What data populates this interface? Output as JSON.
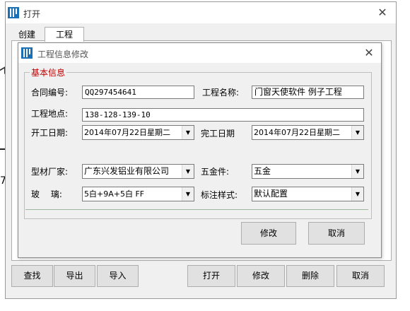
{
  "outer_window": {
    "title": "打开",
    "close_glyph": "✕",
    "tabs": [
      "创建",
      "工程"
    ]
  },
  "inner_dialog": {
    "title": "工程信息修改",
    "close_glyph": "✕",
    "group_title": "基本信息",
    "fields": {
      "contract_no": {
        "label": "合同编号:",
        "value": "QQ297454641"
      },
      "project_name": {
        "label": "工程名称:",
        "value": "门窗天使软件 例子工程"
      },
      "project_site": {
        "label": "工程地点:",
        "value": "138-128-139-10"
      },
      "start_date": {
        "label": "开工日期:",
        "value": "2014年07月22日星期二"
      },
      "finish_date": {
        "label": "完工日期",
        "value": "2014年07月22日星期二"
      },
      "profile_maker": {
        "label": "型材厂家:",
        "value": "广东兴发铝业有限公司"
      },
      "hardware": {
        "label": "五金件:",
        "value": "五金"
      },
      "glass": {
        "label": "玻　 璃:",
        "value": "5白+9A+5白 FF"
      },
      "label_style": {
        "label": "标注样式:",
        "value": "默认配置"
      }
    },
    "buttons": {
      "modify": "修改",
      "cancel": "取消"
    },
    "dropdown_glyph": "▼"
  },
  "bottom_buttons": {
    "find": "查找",
    "export": "导出",
    "import": "导入",
    "open": "打开",
    "modify": "修改",
    "delete": "删除",
    "cancel": "取消"
  },
  "background_fragment": "7",
  "colors": {
    "group_title": "#c00000",
    "icon": "#1a6fb5",
    "separator": "#9fb79f"
  },
  "icons": [
    "app-icon",
    "close-icon",
    "dropdown-arrow-icon"
  ]
}
